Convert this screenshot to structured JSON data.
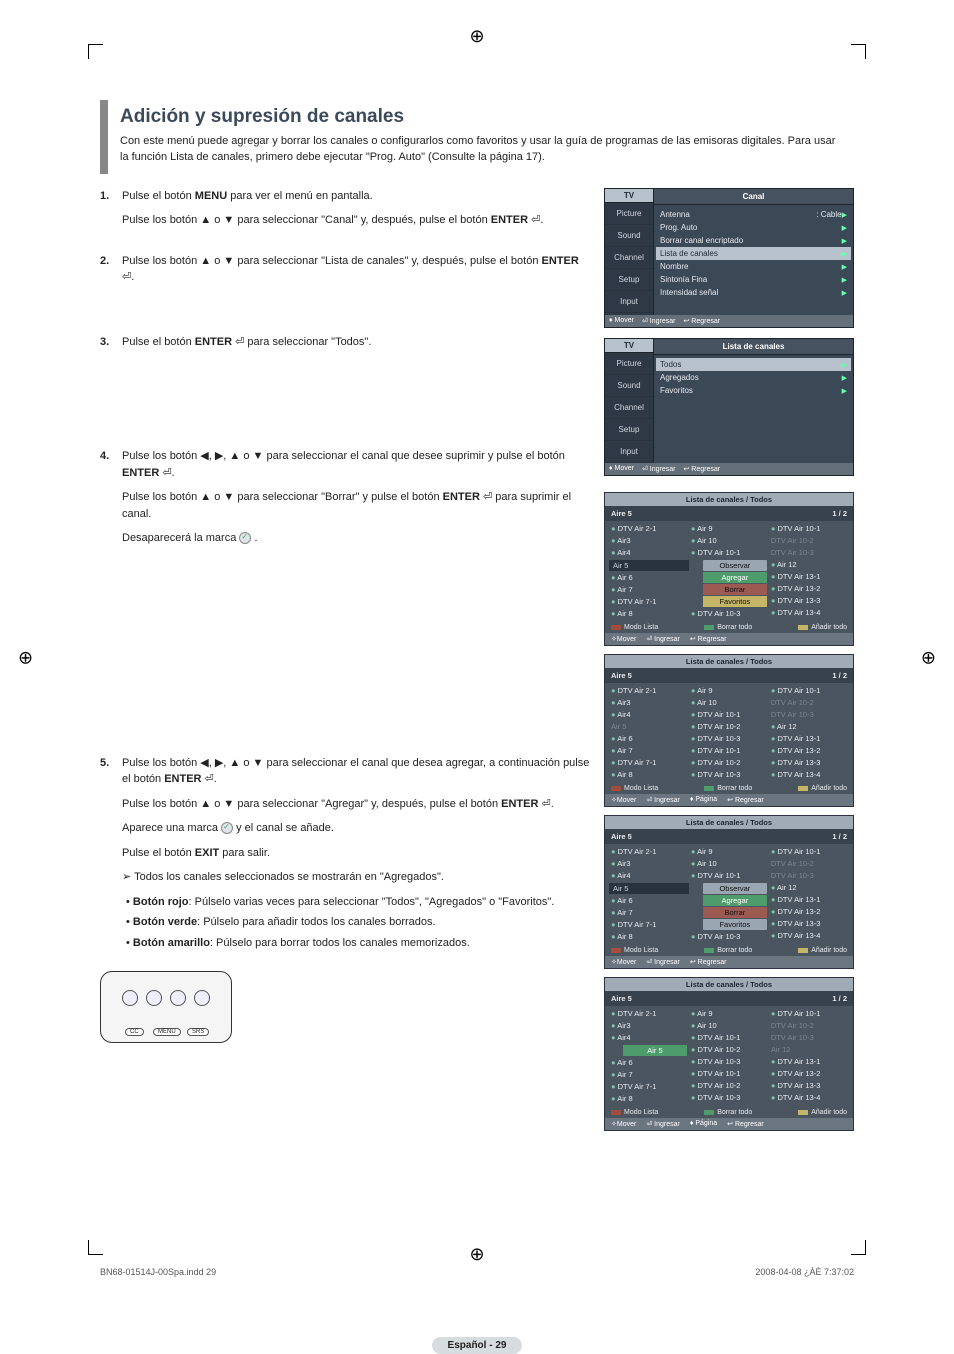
{
  "page_title": "Adición y supresión de canales",
  "intro": "Con este menú puede agregar y borrar los canales o configurarlos como favoritos y usar la guía de programas de las emisoras digitales. Para usar la función Lista de canales, primero debe ejecutar \"Prog. Auto\" (Consulte la página 17).",
  "steps": [
    {
      "n": "1.",
      "paras": [
        "Pulse el botón <b>MENU</b> para ver el menú en pantalla.",
        "Pulse los botón ▲ o ▼ para seleccionar \"Canal\" y, después, pulse el botón <b>ENTER</b> ⏎."
      ]
    },
    {
      "n": "2.",
      "paras": [
        "Pulse los botón ▲ o ▼ para seleccionar \"Lista de canales\" y, después, pulse el botón <b>ENTER</b> ⏎."
      ]
    },
    {
      "n": "3.",
      "paras": [
        "Pulse el botón <b>ENTER</b> ⏎ para seleccionar \"Todos\"."
      ]
    },
    {
      "n": "4.",
      "paras": [
        "Pulse los botón ◀, ▶, ▲ o ▼ para seleccionar el canal que desee suprimir y pulse el botón <b>ENTER</b> ⏎.",
        "Pulse los botón ▲ o ▼ para seleccionar \"Borrar\" y pulse el botón <b>ENTER</b> ⏎ para suprimir el canal.",
        "Desaparecerá la marca <span class=\"check-icon\"></span> ."
      ]
    },
    {
      "n": "5.",
      "paras": [
        "Pulse los botón ◀, ▶, ▲ o ▼ para seleccionar el canal que desea agregar, a continuación pulse el botón <b>ENTER</b> ⏎.",
        "Pulse los botón ▲ o ▼ para seleccionar \"Agregar\" y, después, pulse el botón <b>ENTER</b> ⏎.",
        "Aparece una marca <span class=\"check-icon\"></span> y  el canal se añade.",
        "Pulse el botón <b>EXIT</b> para salir."
      ],
      "note": "Todos los canales seleccionados se mostrarán en \"Agregados\".",
      "bullets": [
        "<b>Botón rojo</b>: Púlselo varias veces para seleccionar \"Todos\", \"Agregados\" o \"Favoritos\".",
        "<b>Botón verde</b>: Púlselo para añadir todos los canales borrados.",
        "<b>Botón amarillo</b>: Púlselo para borrar todos los canales memorizados."
      ]
    }
  ],
  "remote": {
    "b1": "CC",
    "b2": "MENU",
    "b3": "SRS"
  },
  "osd1": {
    "side_hdr": "TV",
    "side": [
      "Picture",
      "Sound",
      "Channel",
      "Setup",
      "Input"
    ],
    "title": "Canal",
    "items": [
      {
        "l": "Antenna",
        "r": ": Cable",
        "arrow": true
      },
      {
        "l": "Prog. Auto",
        "arrow": true
      },
      {
        "l": "Borrar canal encriptado",
        "arrow": true
      },
      {
        "l": "Lista de canales",
        "arrow": true,
        "hl": true
      },
      {
        "l": "Nombre",
        "arrow": true
      },
      {
        "l": "Sintonía Fina",
        "arrow": true
      },
      {
        "l": "Intensidad señal",
        "arrow": true
      }
    ],
    "foot": [
      "♦ Mover",
      "⏎ Ingresar",
      "↩ Regresar"
    ]
  },
  "osd2": {
    "side_hdr": "TV",
    "side": [
      "Picture",
      "Sound",
      "Channel",
      "Setup",
      "Input"
    ],
    "title": "Lista de canales",
    "items": [
      {
        "l": "Todos",
        "arrow": true,
        "hl": true
      },
      {
        "l": "Agregados",
        "arrow": true
      },
      {
        "l": "Favoritos",
        "arrow": true
      }
    ],
    "foot": [
      "♦ Mover",
      "⏎ Ingresar",
      "↩ Regresar"
    ]
  },
  "chlist_title": "Lista de canales / Todos",
  "chlist_sub_l": "Aire 5",
  "chlist_sub_r": "1 / 2",
  "c1": {
    "col1": [
      "DTV Air 2-1",
      "Air3",
      "Air4",
      "Air 5",
      "Air 6",
      "Air 7",
      "DTV Air 7-1",
      "Air 8"
    ],
    "col2": [
      "Air 9",
      "Air 10",
      "DTV Air 10-1",
      "Observar",
      "Agregar",
      "Borrar",
      "Favoritos",
      "DTV Air 10-3"
    ],
    "col3": [
      "DTV Air 10-1",
      "DTV Air 10-2",
      "DTV Air 10-3",
      "Air 12",
      "DTV Air 13-1",
      "DTV Air 13-2",
      "DTV Air 13-3",
      "DTV Air 13-4"
    ],
    "actions": [
      "Modo Lista",
      "Borrar todo",
      "Añadir todo"
    ],
    "foot": [
      "✧Mover",
      "⏎ Ingresar",
      "↩ Regresar"
    ]
  },
  "c2": {
    "col1": [
      "DTV Air 2-1",
      "Air3",
      "Air4",
      "Air 5",
      "Air 6",
      "Air 7",
      "DTV Air 7-1",
      "Air 8"
    ],
    "col2": [
      "Air 9",
      "Air 10",
      "DTV Air 10-1",
      "DTV Air 10-2",
      "DTV Air 10-3",
      "DTV Air 10-1",
      "DTV Air 10-2",
      "DTV Air 10-3"
    ],
    "col3": [
      "DTV Air 10-1",
      "DTV Air 10-2",
      "DTV Air 10-3",
      "Air 12",
      "DTV Air 13-1",
      "DTV Air 13-2",
      "DTV Air 13-3",
      "DTV Air 13-4"
    ],
    "actions": [
      "Modo Lista",
      "Borrar todo",
      "Añadir todo"
    ],
    "foot": [
      "✧Mover",
      "⏎ Ingresar",
      "♦ Página",
      "↩ Regresar"
    ]
  },
  "c3": {
    "col1": [
      "DTV Air 2-1",
      "Air3",
      "Air4",
      "Air 5",
      "Air 6",
      "Air 7",
      "DTV Air 7-1",
      "Air 8"
    ],
    "col2": [
      "Air 9",
      "Air 10",
      "DTV Air 10-1",
      "Observar",
      "Agregar",
      "Borrar",
      "Favoritos",
      "DTV Air 10-3"
    ],
    "col3": [
      "DTV Air 10-1",
      "DTV Air 10-2",
      "DTV Air 10-3",
      "Air 12",
      "DTV Air 13-1",
      "DTV Air 13-2",
      "DTV Air 13-3",
      "DTV Air 13-4"
    ],
    "actions": [
      "Modo Lista",
      "Borrar todo",
      "Añadir todo"
    ],
    "foot": [
      "✧Mover",
      "⏎ Ingresar",
      "↩ Regresar"
    ]
  },
  "c4": {
    "col1": [
      "DTV Air 2-1",
      "Air3",
      "Air4",
      "Air 5",
      "Air 6",
      "Air 7",
      "DTV Air 7-1",
      "Air 8"
    ],
    "col2": [
      "Air 9",
      "Air 10",
      "DTV Air 10-1",
      "DTV Air 10-2",
      "DTV Air 10-3",
      "DTV Air 10-1",
      "DTV Air 10-2",
      "DTV Air 10-3"
    ],
    "col3": [
      "DTV Air 10-1",
      "DTV Air 10-2",
      "DTV Air 10-3",
      "Air 12",
      "DTV Air 13-1",
      "DTV Air 13-2",
      "DTV Air 13-3",
      "DTV Air 13-4"
    ],
    "actions": [
      "Modo Lista",
      "Borrar todo",
      "Añadir todo"
    ],
    "foot": [
      "✧Mover",
      "⏎ Ingresar",
      "♦ Página",
      "↩ Regresar"
    ]
  },
  "page_label": "Español - 29",
  "imprint_l": "BN68-01514J-00Spa.indd   29",
  "imprint_r": "2008-04-08   ¿ÀÈ 7:37:02"
}
